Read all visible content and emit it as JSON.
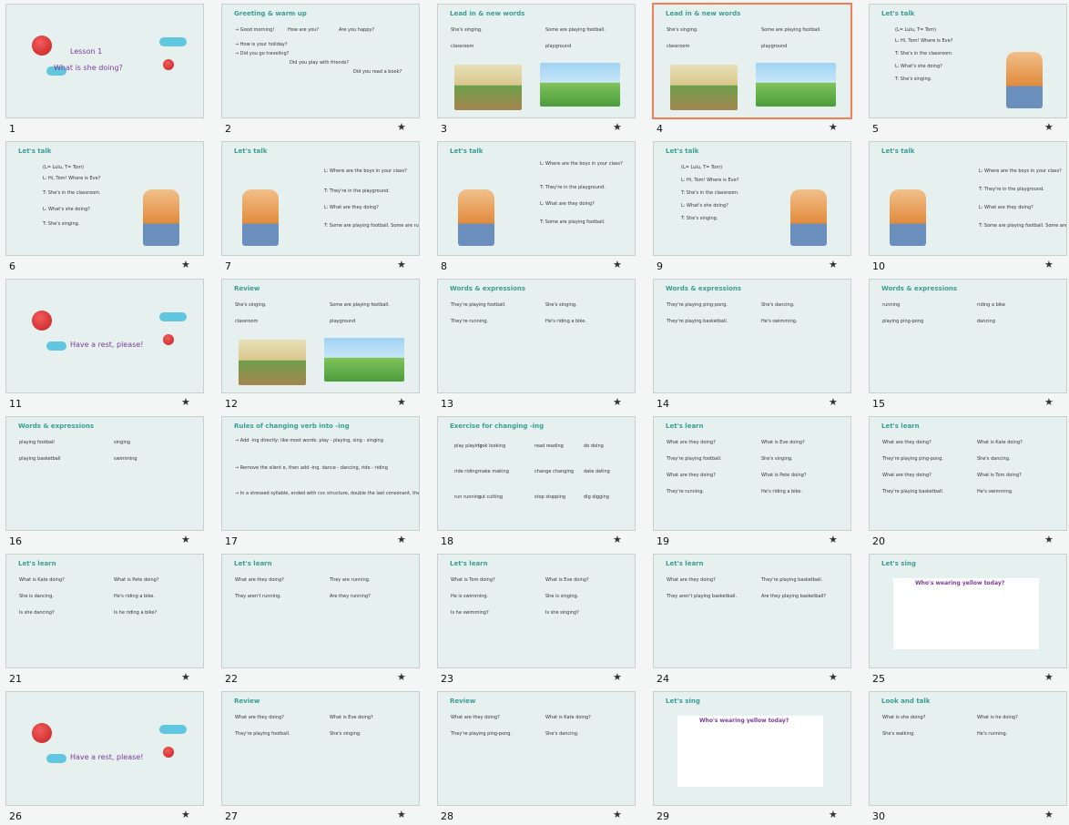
{
  "slides": [
    {
      "n": "1",
      "title": "",
      "lines": [
        "Lesson 1",
        "What is she doing?"
      ]
    },
    {
      "n": "2",
      "title": "Greeting & warm up",
      "lines": [
        "→ Good morning!",
        "How are you?",
        "Are you happy?",
        "→ How is your holiday?",
        "→ Did you go traveling?",
        "Did you play with friends?",
        "Did you read a book?"
      ]
    },
    {
      "n": "3",
      "title": "Lead in & new words",
      "lines": [
        "She's singing.",
        "Some are playing football.",
        "classroom",
        "playground"
      ]
    },
    {
      "n": "4",
      "title": "Lead in & new words",
      "lines": [
        "She's singing.",
        "Some are playing football.",
        "classroom",
        "playground"
      ]
    },
    {
      "n": "5",
      "title": "Let's talk",
      "lines": [
        "(L= Lulu, T= Tom)",
        "L: Hi, Tom! Where is Eve?",
        "T: She's in the classroom.",
        "L: What's she doing?",
        "T: She's singing."
      ]
    },
    {
      "n": "6",
      "title": "Let's talk",
      "lines": [
        "(L= Lulu, T= Tom)",
        "L: Hi, Tom! Where is Eve?",
        "T: She's in the classroom.",
        "L: What's she doing?",
        "T: She's singing."
      ]
    },
    {
      "n": "7",
      "title": "Let's talk",
      "lines": [
        "L: Where are the boys in your class?",
        "T: They're in the playground.",
        "L: What are they doing?",
        "T: Some are playing football. Some are running."
      ]
    },
    {
      "n": "8",
      "title": "Let's talk",
      "lines": [
        "L: Where are the boys in your class?",
        "T: They're in the playground.",
        "L: What are they doing?",
        "T: Some are playing football."
      ]
    },
    {
      "n": "9",
      "title": "Let's talk",
      "lines": [
        "(L= Lulu, T= Tom)",
        "L: Hi, Tom! Where is Eve?",
        "T: She's in the classroom.",
        "L: What's she doing?",
        "T: She's singing."
      ]
    },
    {
      "n": "10",
      "title": "Let's talk",
      "lines": [
        "L: Where are the boys in your class?",
        "T: They're in the playground.",
        "L: What are they doing?",
        "T: Some are playing football. Some are running."
      ]
    },
    {
      "n": "11",
      "title": "",
      "lines": [
        "Have a rest, please!"
      ]
    },
    {
      "n": "12",
      "title": "Review",
      "lines": [
        "She's singing.",
        "Some are playing football.",
        "classroom",
        "playground"
      ]
    },
    {
      "n": "13",
      "title": "Words & expressions",
      "lines": [
        "They're playing football.",
        "She's singing.",
        "They're running.",
        "He's riding a bike."
      ]
    },
    {
      "n": "14",
      "title": "Words & expressions",
      "lines": [
        "They're playing ping-pong.",
        "She's dancing.",
        "They're playing basketball.",
        "He's swimming."
      ]
    },
    {
      "n": "15",
      "title": "Words & expressions",
      "lines": [
        "running",
        "riding a bike",
        "playing ping-pong",
        "dancing"
      ]
    },
    {
      "n": "16",
      "title": "Words & expressions",
      "lines": [
        "playing football",
        "singing",
        "playing basketball",
        "swimming"
      ]
    },
    {
      "n": "17",
      "title": "Rules of changing verb into -ing",
      "lines": [
        "→ Add -ing directly; like most words. play - playing, sing - singing",
        "→ Remove the silent e, then add -ing. dance - dancing, ride - riding",
        "→ In a stressed syllable, ended with cvc structure, double the last consonant, then add -ing. run - running, swim - swimming"
      ]
    },
    {
      "n": "18",
      "title": "Exercise for changing -ing",
      "lines": [
        "play playing",
        "look looking",
        "read reading",
        "do doing",
        "ride riding",
        "make making",
        "change changing",
        "date dating",
        "run running",
        "cut cutting",
        "stop stopping",
        "dig digging"
      ]
    },
    {
      "n": "19",
      "title": "Let's learn",
      "lines": [
        "What are they doing?",
        "What is Eve doing?",
        "They're playing football.",
        "She's singing.",
        "What are they doing?",
        "What is Pete doing?",
        "They're running.",
        "He's riding a bike."
      ]
    },
    {
      "n": "20",
      "title": "Let's learn",
      "lines": [
        "What are they doing?",
        "What is Kate doing?",
        "They're playing ping-pong.",
        "She's dancing.",
        "What are they doing?",
        "What is Tom doing?",
        "They're playing basketball.",
        "He's swimming."
      ]
    },
    {
      "n": "21",
      "title": "Let's learn",
      "lines": [
        "What is Kate doing?",
        "What is Pete doing?",
        "She is dancing.",
        "He's riding a bike.",
        "Is she dancing?",
        "Is he riding a bike?"
      ]
    },
    {
      "n": "22",
      "title": "Let's learn",
      "lines": [
        "What are they doing?",
        "They are running.",
        "They aren't running.",
        "Are they running?"
      ]
    },
    {
      "n": "23",
      "title": "Let's learn",
      "lines": [
        "What is Tom doing?",
        "What is Eve doing?",
        "He is swimming.",
        "She is singing.",
        "Is he swimming?",
        "Is she singing?"
      ]
    },
    {
      "n": "24",
      "title": "Let's learn",
      "lines": [
        "What are they doing?",
        "They're playing basketball.",
        "They aren't playing basketball.",
        "Are they playing basketball?"
      ]
    },
    {
      "n": "25",
      "title": "Let's sing",
      "lines": [
        "Who's wearing yellow today?"
      ]
    },
    {
      "n": "26",
      "title": "",
      "lines": [
        "Have a rest, please!"
      ]
    },
    {
      "n": "27",
      "title": "Review",
      "lines": [
        "What are they doing?",
        "What is Eve doing?",
        "They're playing football.",
        "She's singing."
      ]
    },
    {
      "n": "28",
      "title": "Review",
      "lines": [
        "What are they doing?",
        "What is Kate doing?",
        "They're playing ping-pong.",
        "She's dancing."
      ]
    },
    {
      "n": "29",
      "title": "Let's sing",
      "lines": [
        "Who's wearing yellow today?"
      ]
    },
    {
      "n": "30",
      "title": "Look and talk",
      "lines": [
        "What is she doing?",
        "What is he doing?",
        "She's walking.",
        "He's running."
      ]
    }
  ],
  "selected_index": 3,
  "star_icon": "★"
}
